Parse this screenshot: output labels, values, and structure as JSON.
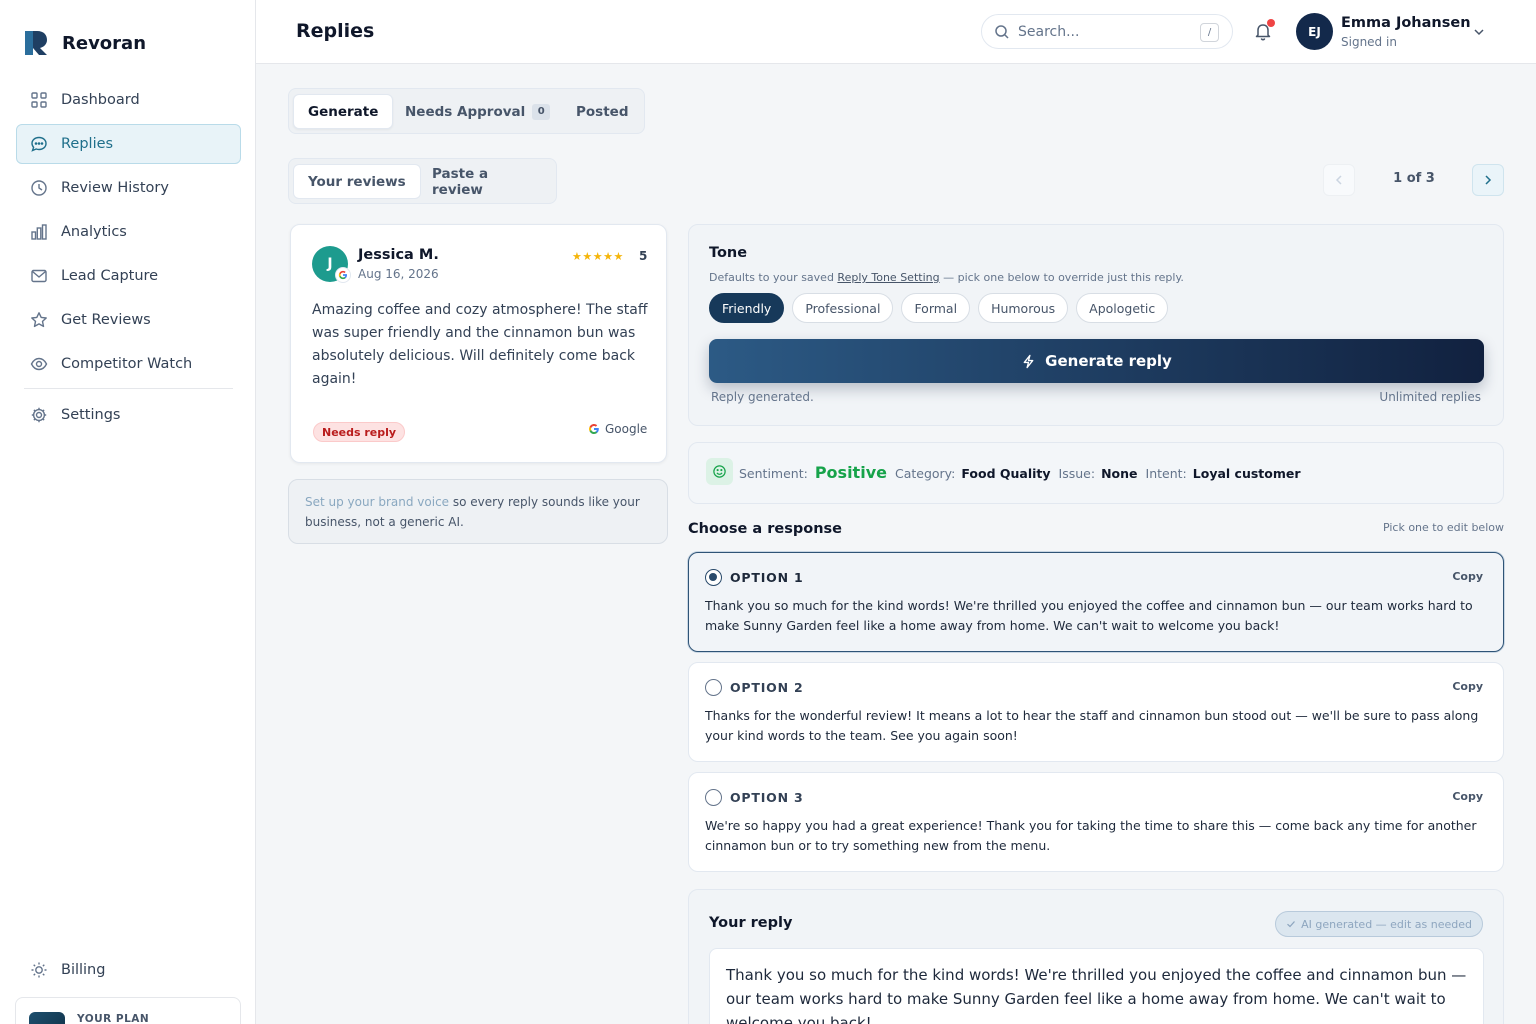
{
  "brand": {
    "name": "Revoran"
  },
  "nav": {
    "items": [
      {
        "label": "Dashboard",
        "icon": "grid-icon"
      },
      {
        "label": "Replies",
        "icon": "chat-icon",
        "active": true
      },
      {
        "label": "Review History",
        "icon": "clock-icon"
      },
      {
        "label": "Analytics",
        "icon": "bar-chart-icon"
      },
      {
        "label": "Lead Capture",
        "icon": "mail-icon"
      },
      {
        "label": "Get Reviews",
        "icon": "star-icon"
      },
      {
        "label": "Competitor Watch",
        "icon": "eye-icon"
      }
    ],
    "settings": "Settings",
    "billing": "Billing",
    "plan_label": "YOUR PLAN"
  },
  "header": {
    "title": "Replies",
    "search_placeholder": "Search...",
    "search_shortcut": "/",
    "user": {
      "initials": "EJ",
      "name": "Emma Johansen",
      "status": "Signed in"
    }
  },
  "tabs": [
    {
      "label": "Generate",
      "active": true
    },
    {
      "label": "Needs Approval",
      "count": "0"
    },
    {
      "label": "Posted"
    }
  ],
  "subtabs": [
    {
      "label": "Your reviews",
      "active": true
    },
    {
      "label": "Paste a review"
    }
  ],
  "pager": {
    "text": "1 of 3"
  },
  "review": {
    "initial": "J",
    "name": "Jessica M.",
    "date": "Aug 16, 2026",
    "stars": "★★★★★",
    "rating": "5",
    "text": "Amazing coffee and cozy atmosphere! The staff was super friendly and the cinnamon bun was absolutely delicious. Will definitely come back again!",
    "status": "Needs reply",
    "source": "Google"
  },
  "brand_voice": {
    "link": "Set up your brand voice",
    "rest": " so every reply sounds like your business, not a generic AI."
  },
  "tone": {
    "title": "Tone",
    "sub_prefix": "Defaults to your saved ",
    "sub_link": "Reply Tone Setting",
    "sub_suffix": " — pick one below to override just this reply.",
    "options": [
      "Friendly",
      "Professional",
      "Formal",
      "Humorous",
      "Apologetic"
    ],
    "selected": "Friendly",
    "generate_label": "Generate reply",
    "status": "Reply generated.",
    "quota": "Unlimited replies"
  },
  "sentiment": {
    "sentiment_label": "Sentiment:",
    "sentiment_value": "Positive",
    "category_label": "Category:",
    "category_value": "Food Quality",
    "issue_label": "Issue:",
    "issue_value": "None",
    "intent_label": "Intent:",
    "intent_value": "Loyal customer"
  },
  "responses": {
    "title": "Choose a response",
    "hint": "Pick one to edit below",
    "copy_label": "Copy",
    "options": [
      {
        "label": "OPTION 1",
        "text": "Thank you so much for the kind words! We're thrilled you enjoyed the coffee and cinnamon bun — our team works hard to make Sunny Garden feel like a home away from home. We can't wait to welcome you back!",
        "selected": true
      },
      {
        "label": "OPTION 2",
        "text": "Thanks for the wonderful review! It means a lot to hear the staff and cinnamon bun stood out — we'll be sure to pass along your kind words to the team. See you again soon!"
      },
      {
        "label": "OPTION 3",
        "text": "We're so happy you had a great experience! Thank you for taking the time to share this — come back any time for another cinnamon bun or to try something new from the menu."
      }
    ]
  },
  "reply": {
    "title": "Your reply",
    "badge": "AI generated — edit as needed",
    "text": "Thank you so much for the kind words! We're thrilled you enjoyed the coffee and cinnamon bun — our team works hard to make Sunny Garden feel like a home away from home. We can't wait to welcome you back!"
  },
  "colors": {
    "accent": "#1f6f8b",
    "primary_dark": "#17395a",
    "positive": "#16a34a",
    "alert": "#ef4444",
    "star": "#f5b50a"
  }
}
